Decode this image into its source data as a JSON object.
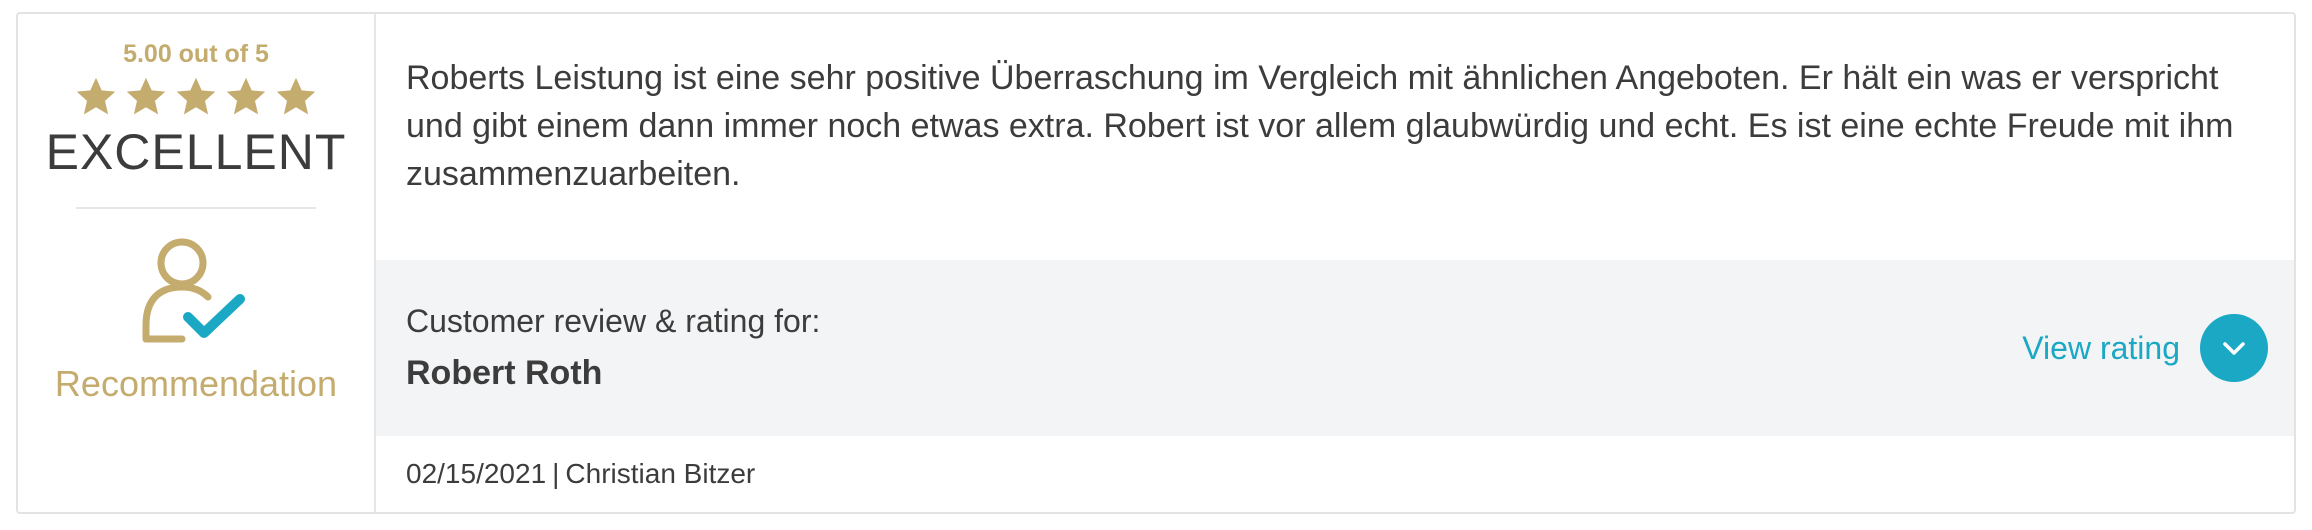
{
  "rating": {
    "score_text": "5.00 out of 5",
    "stars": 5,
    "stars_max": 5,
    "verdict": "EXCELLENT",
    "badge_label": "Recommendation",
    "badge_icon": "user-check-icon",
    "star_icon": "star-icon"
  },
  "review": {
    "text": "Roberts Leistung ist eine sehr positive Überraschung im Vergleich mit ähnlichen Angeboten. Er hält ein was er verspricht und gibt einem dann immer noch etwas extra. Robert ist vor allem glaubwürdig und echt. Es ist eine echte Freude mit ihm zusammenzuarbeiten."
  },
  "info": {
    "caption": "Customer review & rating for:",
    "name": "Robert Roth",
    "view_rating_label": "View rating",
    "toggle_icon": "chevron-down-icon"
  },
  "meta": {
    "date": "02/15/2021",
    "separator": "|",
    "author": "Christian Bitzer"
  },
  "colors": {
    "gold": "#c4ab6e",
    "accent": "#1aa8c4",
    "text": "#3c3c3c",
    "band": "#f3f4f6"
  }
}
